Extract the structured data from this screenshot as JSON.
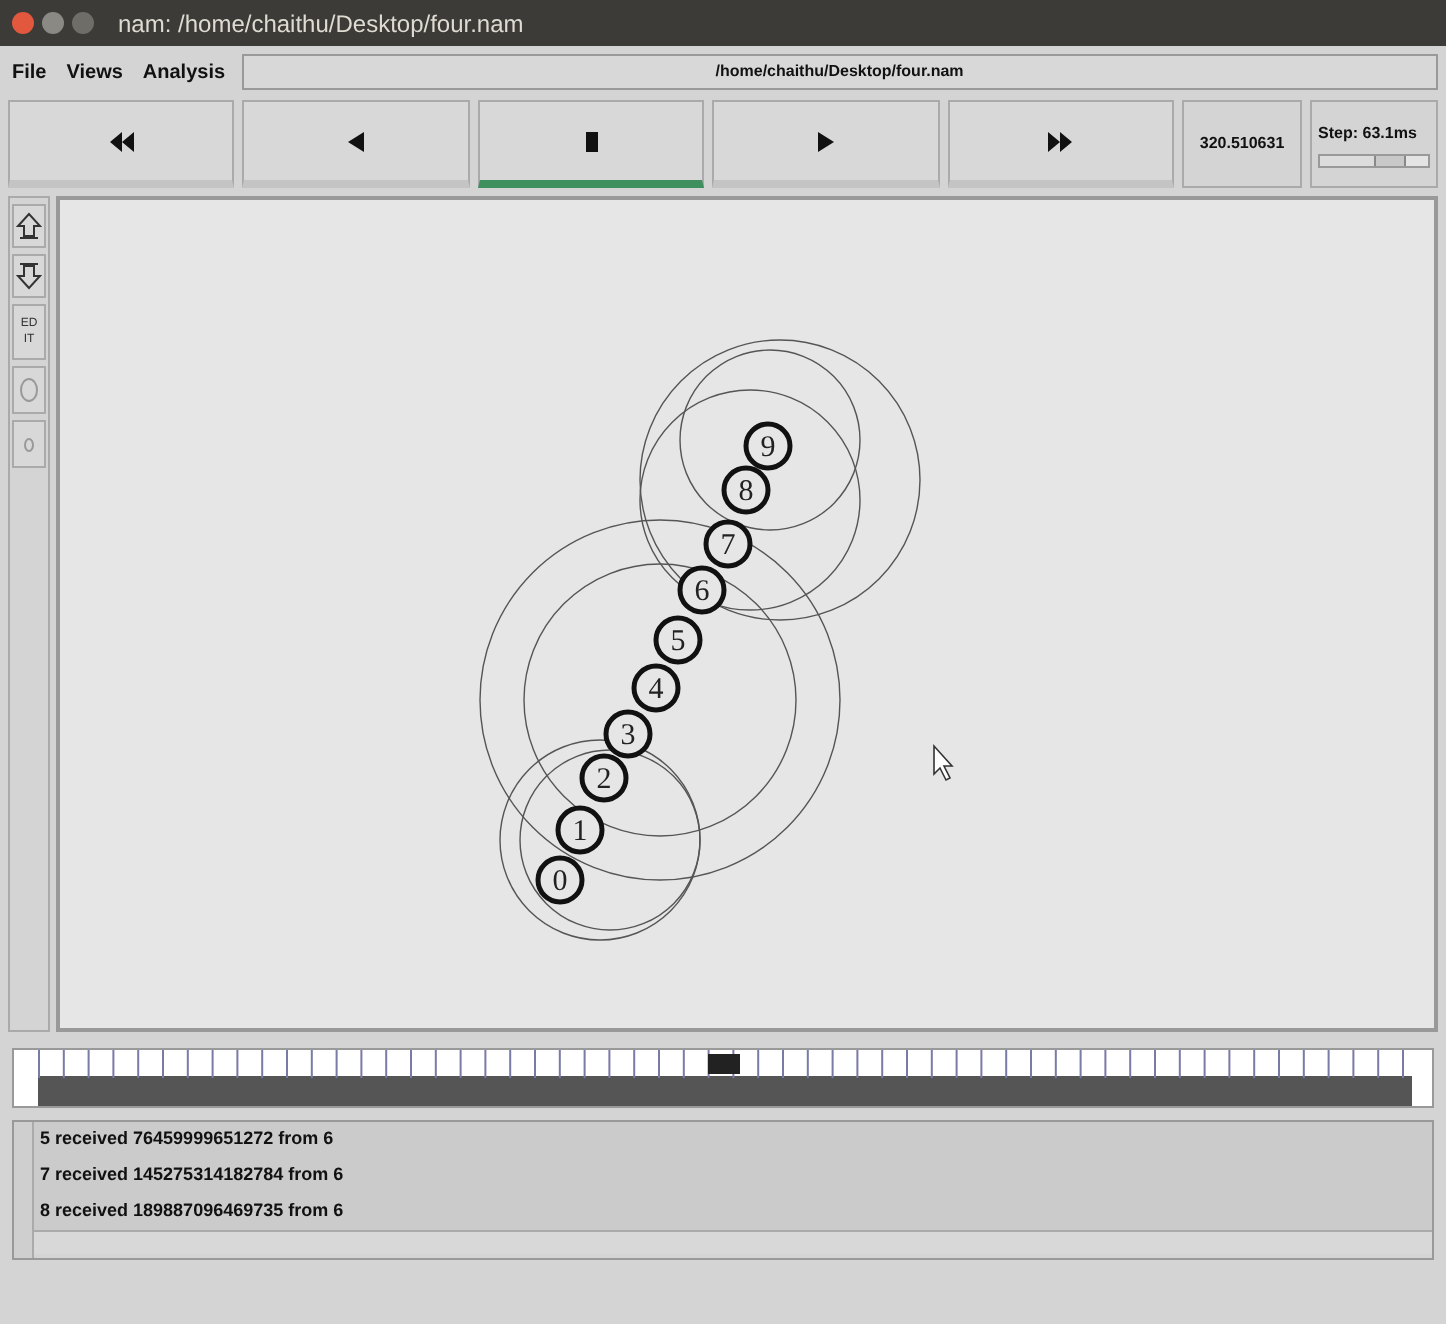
{
  "window": {
    "title": "nam: /home/chaithu/Desktop/four.nam"
  },
  "menu": [
    "File",
    "Views",
    "Analysis"
  ],
  "file_path": "/home/chaithu/Desktop/four.nam",
  "playback": [
    {
      "kind": "rewind",
      "selected": false
    },
    {
      "kind": "back",
      "selected": false
    },
    {
      "kind": "stop",
      "selected": true
    },
    {
      "kind": "play",
      "selected": false
    },
    {
      "kind": "forward",
      "selected": false
    }
  ],
  "time": "320.510631",
  "step": {
    "label": "Step: 63.1ms",
    "level": 0.8
  },
  "tools": [
    {
      "kind": "zoom-in"
    },
    {
      "kind": "zoom-out"
    },
    {
      "kind": "edit",
      "label": "EDIT"
    },
    {
      "kind": "big-circle"
    },
    {
      "kind": "small-circle"
    }
  ],
  "nodes": [
    "0",
    "1",
    "2",
    "3",
    "4",
    "5",
    "6",
    "7",
    "8",
    "9"
  ],
  "log": [
    "5 received 76459999651272 from 6",
    "7 received 145275314182784 from 6",
    "8 received 189887096469735 from 6"
  ]
}
